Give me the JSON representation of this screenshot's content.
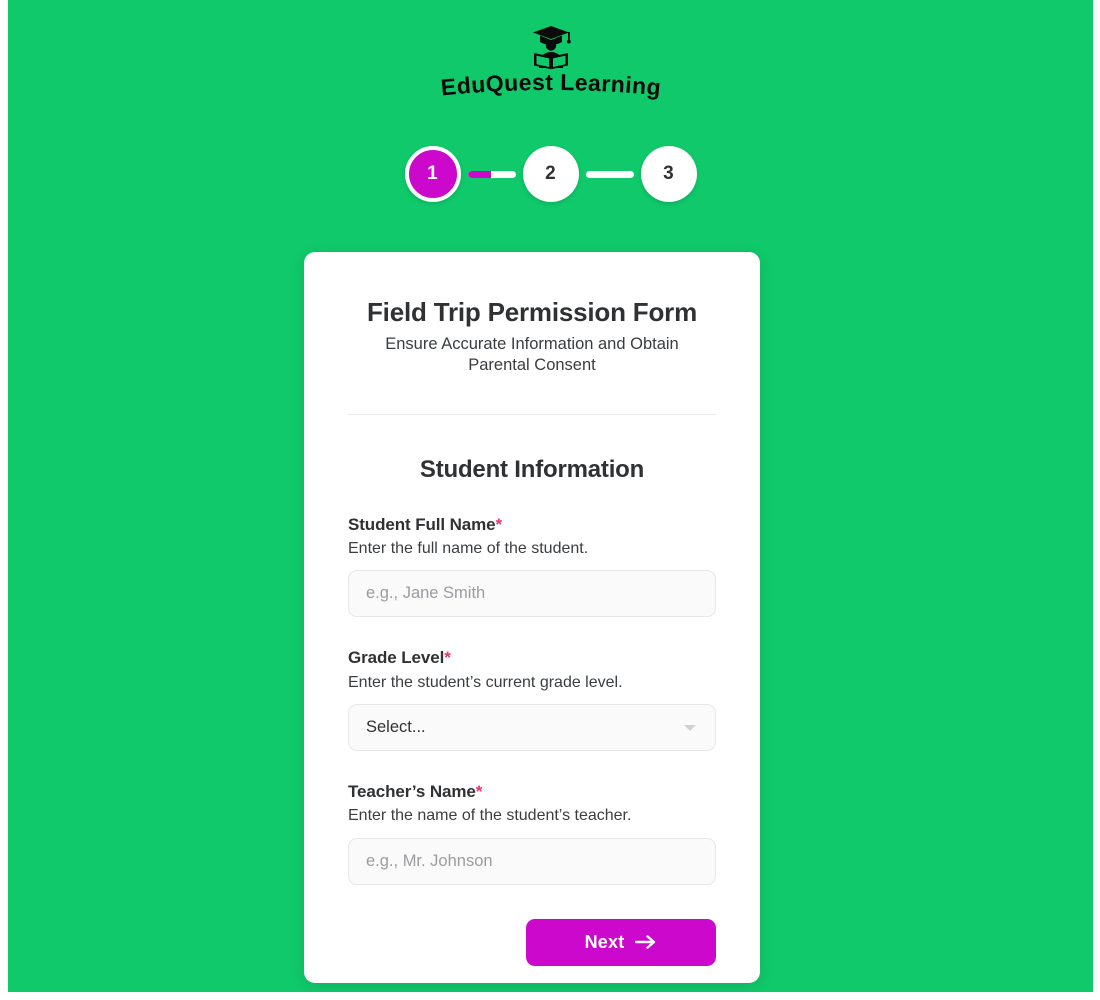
{
  "theme": {
    "background_green": "#10C96B",
    "accent_magenta": "#CB08CB",
    "required_pink": "#E8336D",
    "card_white": "#FFFFFF",
    "text_dark": "#2F3133"
  },
  "brand": {
    "name": "EduQuest Learning",
    "logo_icon": "graduate-reading-book-icon"
  },
  "stepper": {
    "steps": [
      {
        "label": "1",
        "state": "active"
      },
      {
        "label": "2",
        "state": "idle"
      },
      {
        "label": "3",
        "state": "idle"
      }
    ],
    "connectors": [
      {
        "fill_percent": 48
      },
      {
        "fill_percent": 0
      }
    ]
  },
  "form": {
    "title": "Field Trip Permission Form",
    "subtitle": "Ensure Accurate Information and Obtain Parental Consent",
    "section_title": "Student Information",
    "fields": [
      {
        "label": "Student Full Name",
        "required_marker": "*",
        "help": "Enter the full name of the student.",
        "type": "text",
        "value": "",
        "placeholder": "e.g., Jane Smith"
      },
      {
        "label": "Grade Level",
        "required_marker": "*",
        "help": "Enter the student’s current grade level.",
        "type": "select",
        "value": "Select...",
        "placeholder": "Select...",
        "caret_icon": "chevron-down-icon"
      },
      {
        "label": "Teacher’s Name",
        "required_marker": "*",
        "help": "Enter the name of the student’s teacher.",
        "type": "text",
        "value": "",
        "placeholder": "e.g., Mr. Johnson"
      }
    ],
    "next_button": {
      "label": "Next",
      "icon": "arrow-right-icon"
    }
  }
}
